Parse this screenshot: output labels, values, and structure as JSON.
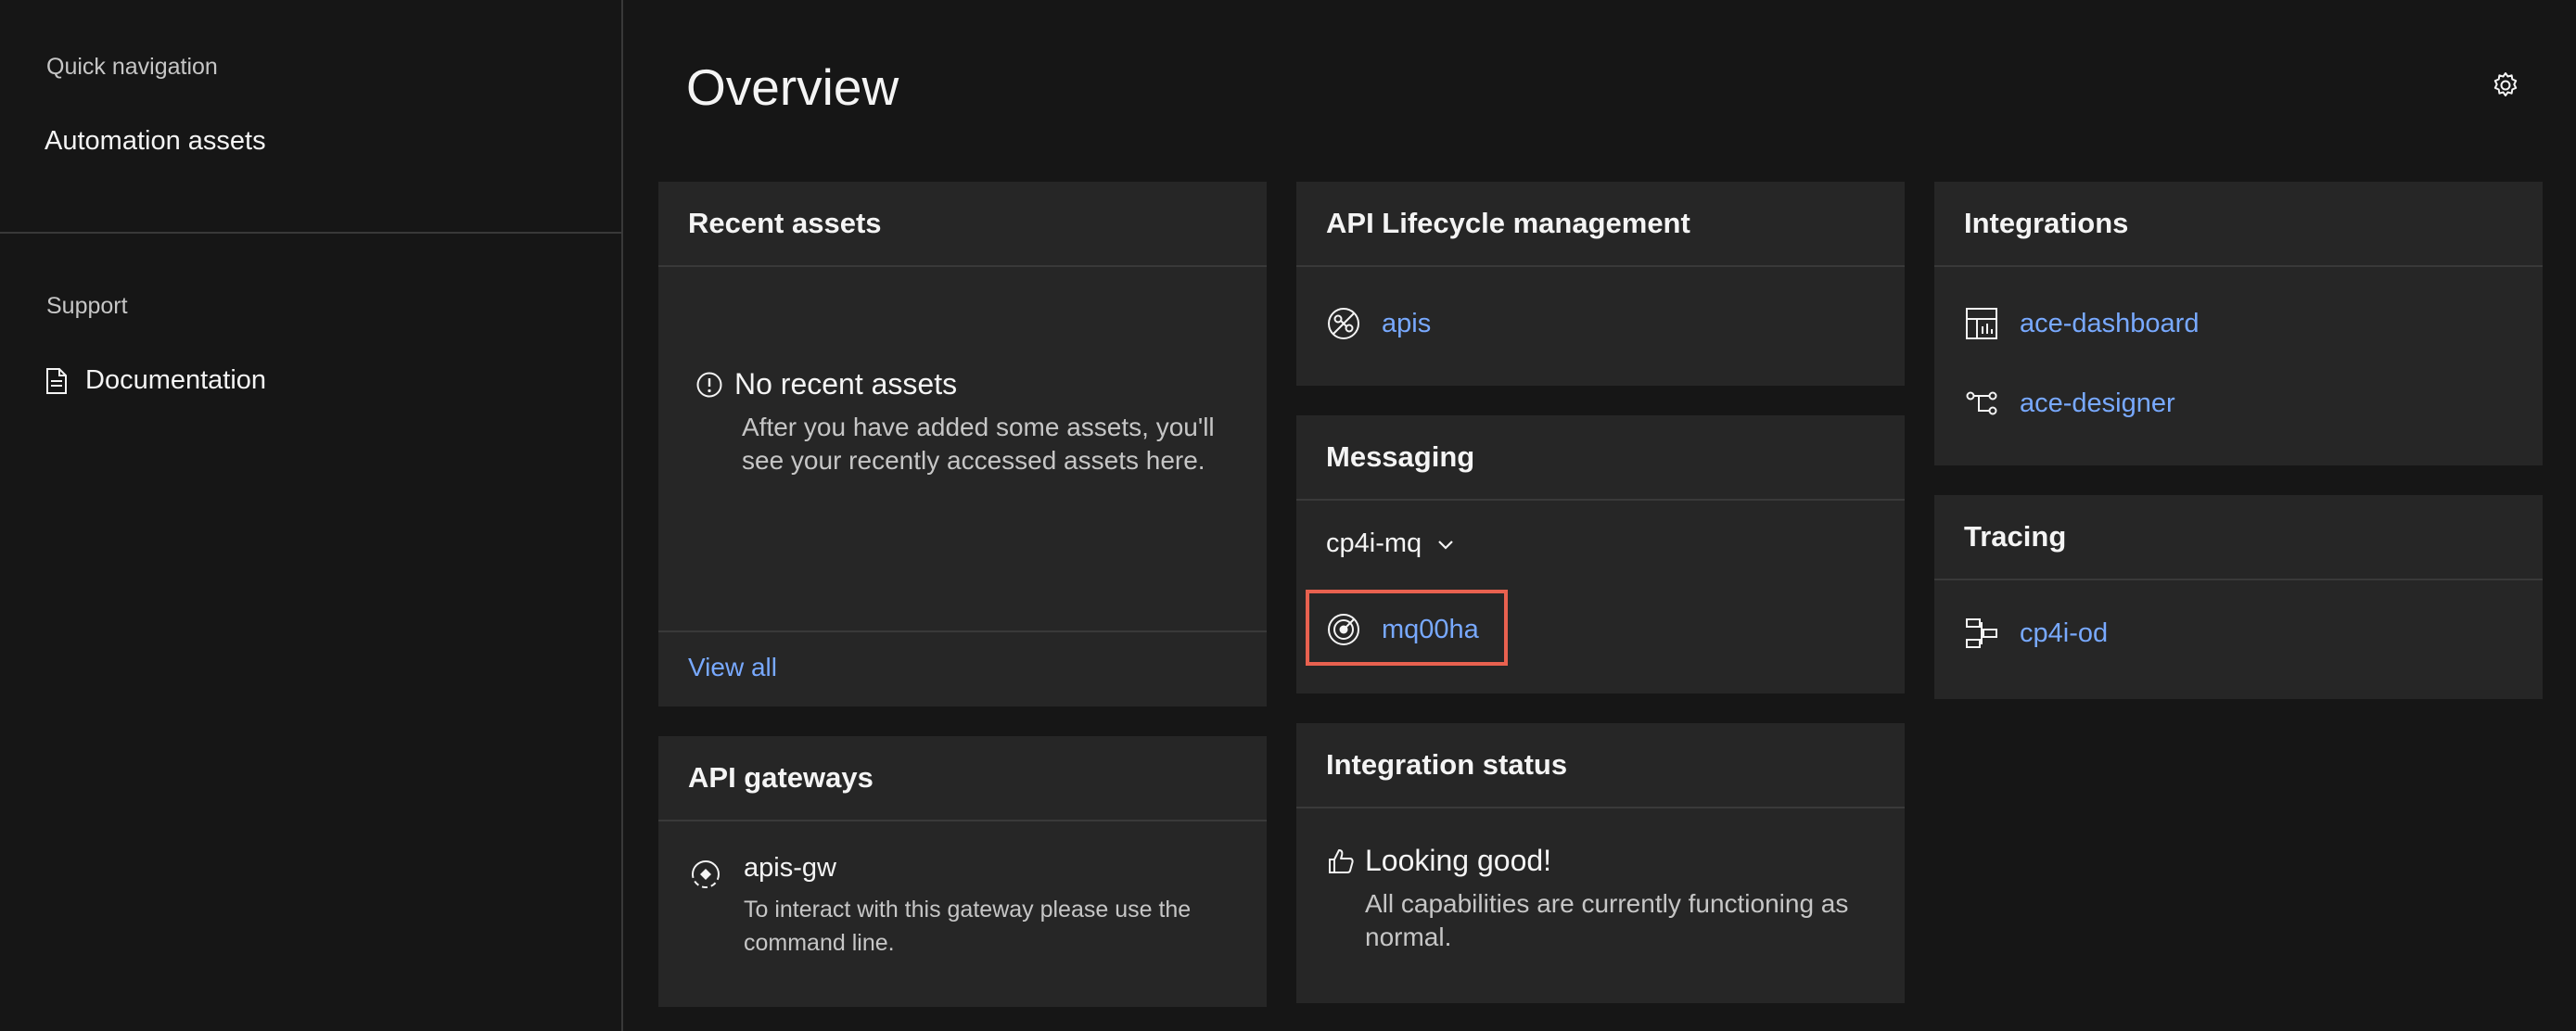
{
  "sidebar": {
    "quick_nav_heading": "Quick navigation",
    "automation_assets": "Automation assets",
    "support_heading": "Support",
    "documentation": "Documentation"
  },
  "page": {
    "title": "Overview"
  },
  "recent_assets": {
    "title": "Recent assets",
    "empty_title": "No recent assets",
    "empty_desc": "After you have added some assets, you'll see your recently accessed assets here.",
    "view_all": "View all"
  },
  "api_lifecycle": {
    "title": "API Lifecycle management",
    "items": [
      {
        "label": "apis",
        "icon": "api-icon"
      }
    ]
  },
  "messaging": {
    "title": "Messaging",
    "selected_namespace": "cp4i-mq",
    "items": [
      {
        "label": "mq00ha",
        "icon": "queue-manager-icon"
      }
    ]
  },
  "integrations": {
    "title": "Integrations",
    "items": [
      {
        "label": "ace-dashboard",
        "icon": "dashboard-icon"
      },
      {
        "label": "ace-designer",
        "icon": "flow-icon"
      }
    ]
  },
  "tracing": {
    "title": "Tracing",
    "items": [
      {
        "label": "cp4i-od",
        "icon": "tracing-icon"
      }
    ]
  },
  "api_gateways": {
    "title": "API gateways",
    "name": "apis-gw",
    "desc": "To interact with this gateway please use the command line."
  },
  "integration_status": {
    "title": "Integration status",
    "status": "Looking good!",
    "desc": "All capabilities are currently functioning as normal."
  },
  "colors": {
    "background": "#161616",
    "card": "#262626",
    "link": "#78a9ff",
    "highlight": "#e8614f"
  }
}
